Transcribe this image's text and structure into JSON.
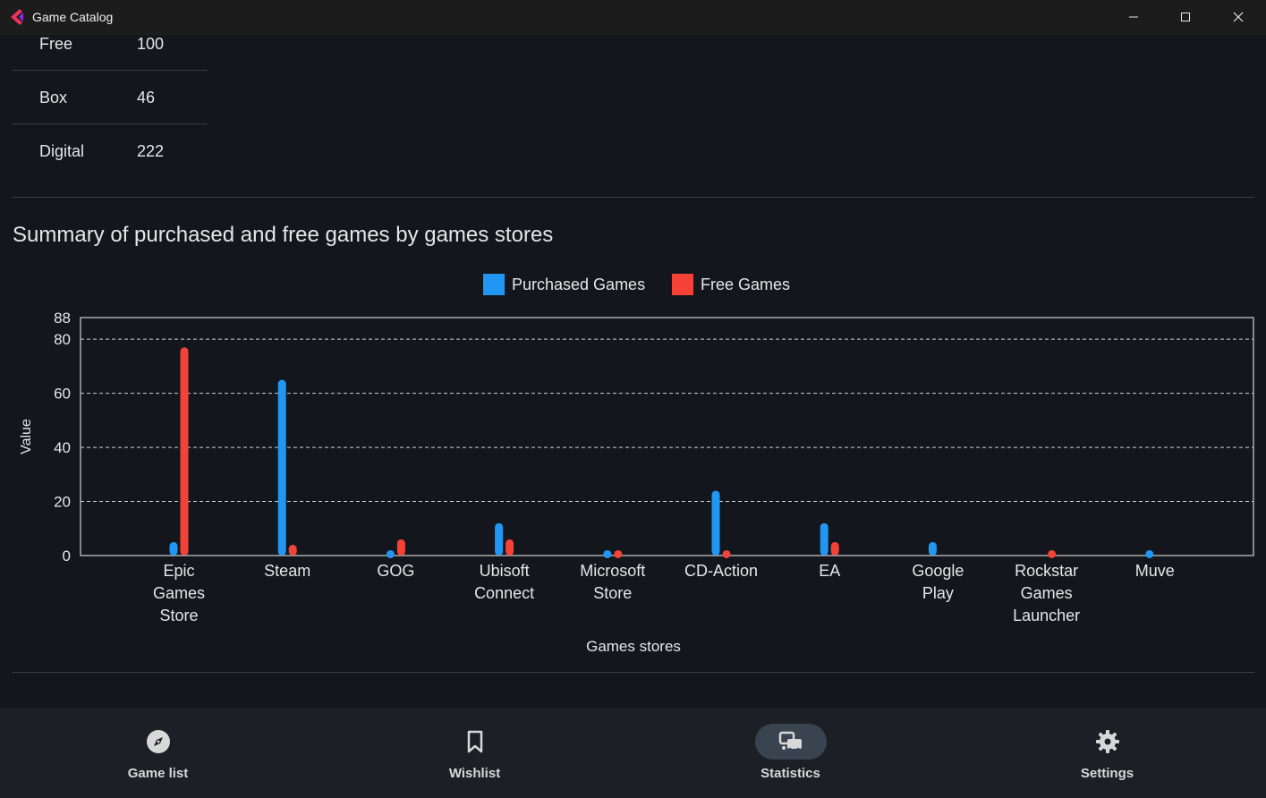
{
  "window": {
    "title": "Game Catalog"
  },
  "type_table": {
    "rows": [
      {
        "label": "Free",
        "value": "100"
      },
      {
        "label": "Box",
        "value": "46"
      },
      {
        "label": "Digital",
        "value": "222"
      }
    ]
  },
  "section": {
    "title": "Summary of purchased and free games by games stores"
  },
  "legend": {
    "purchased": {
      "label": "Purchased Games",
      "color": "#2196f3"
    },
    "free": {
      "label": "Free Games",
      "color": "#f44336"
    }
  },
  "chart_data": {
    "type": "bar",
    "xlabel": "Games stores",
    "ylabel": "Value",
    "ylim": [
      0,
      88
    ],
    "yticks": [
      0,
      20,
      40,
      60,
      80,
      88
    ],
    "grid": true,
    "legend_position": "top-center",
    "categories": [
      [
        "Epic",
        "Games",
        "Store"
      ],
      [
        "Steam"
      ],
      [
        "GOG"
      ],
      [
        "Ubisoft",
        "Connect"
      ],
      [
        "Microsoft",
        "Store"
      ],
      [
        "CD-Action"
      ],
      [
        "EA"
      ],
      [
        "Google",
        "Play"
      ],
      [
        "Rockstar",
        "Games",
        "Launcher"
      ],
      [
        "Muve"
      ]
    ],
    "series": [
      {
        "name": "Purchased Games",
        "color": "#2196f3",
        "values": [
          5,
          65,
          2,
          12,
          2,
          24,
          12,
          5,
          0,
          2
        ]
      },
      {
        "name": "Free Games",
        "color": "#f44336",
        "values": [
          77,
          4,
          6,
          6,
          2,
          2,
          5,
          0,
          2,
          0
        ]
      }
    ]
  },
  "nav": {
    "items": [
      {
        "label": "Game list",
        "icon": "compass-icon",
        "active": false
      },
      {
        "label": "Wishlist",
        "icon": "bookmark-icon",
        "active": false
      },
      {
        "label": "Statistics",
        "icon": "chart-icon",
        "active": true
      },
      {
        "label": "Settings",
        "icon": "gear-icon",
        "active": false
      }
    ]
  }
}
